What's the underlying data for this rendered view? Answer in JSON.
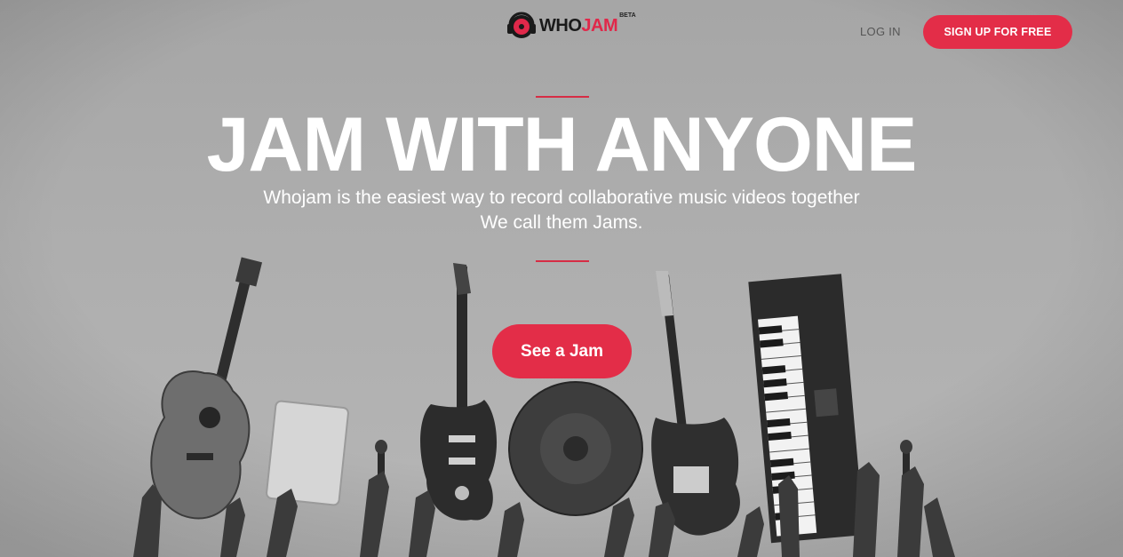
{
  "header": {
    "logo_who": "WHO",
    "logo_jam": "JAM",
    "logo_beta": "BETA",
    "login_label": "LOG IN",
    "signup_label": "SIGN UP FOR FREE"
  },
  "hero": {
    "headline": "JAM WITH ANYONE",
    "subline_1": "Whojam is the easiest way to record collaborative music videos together",
    "subline_2": "We call them Jams.",
    "cta_label": "See a Jam"
  },
  "colors": {
    "accent": "#e32d48",
    "logo_dark": "#1a1a1a"
  }
}
